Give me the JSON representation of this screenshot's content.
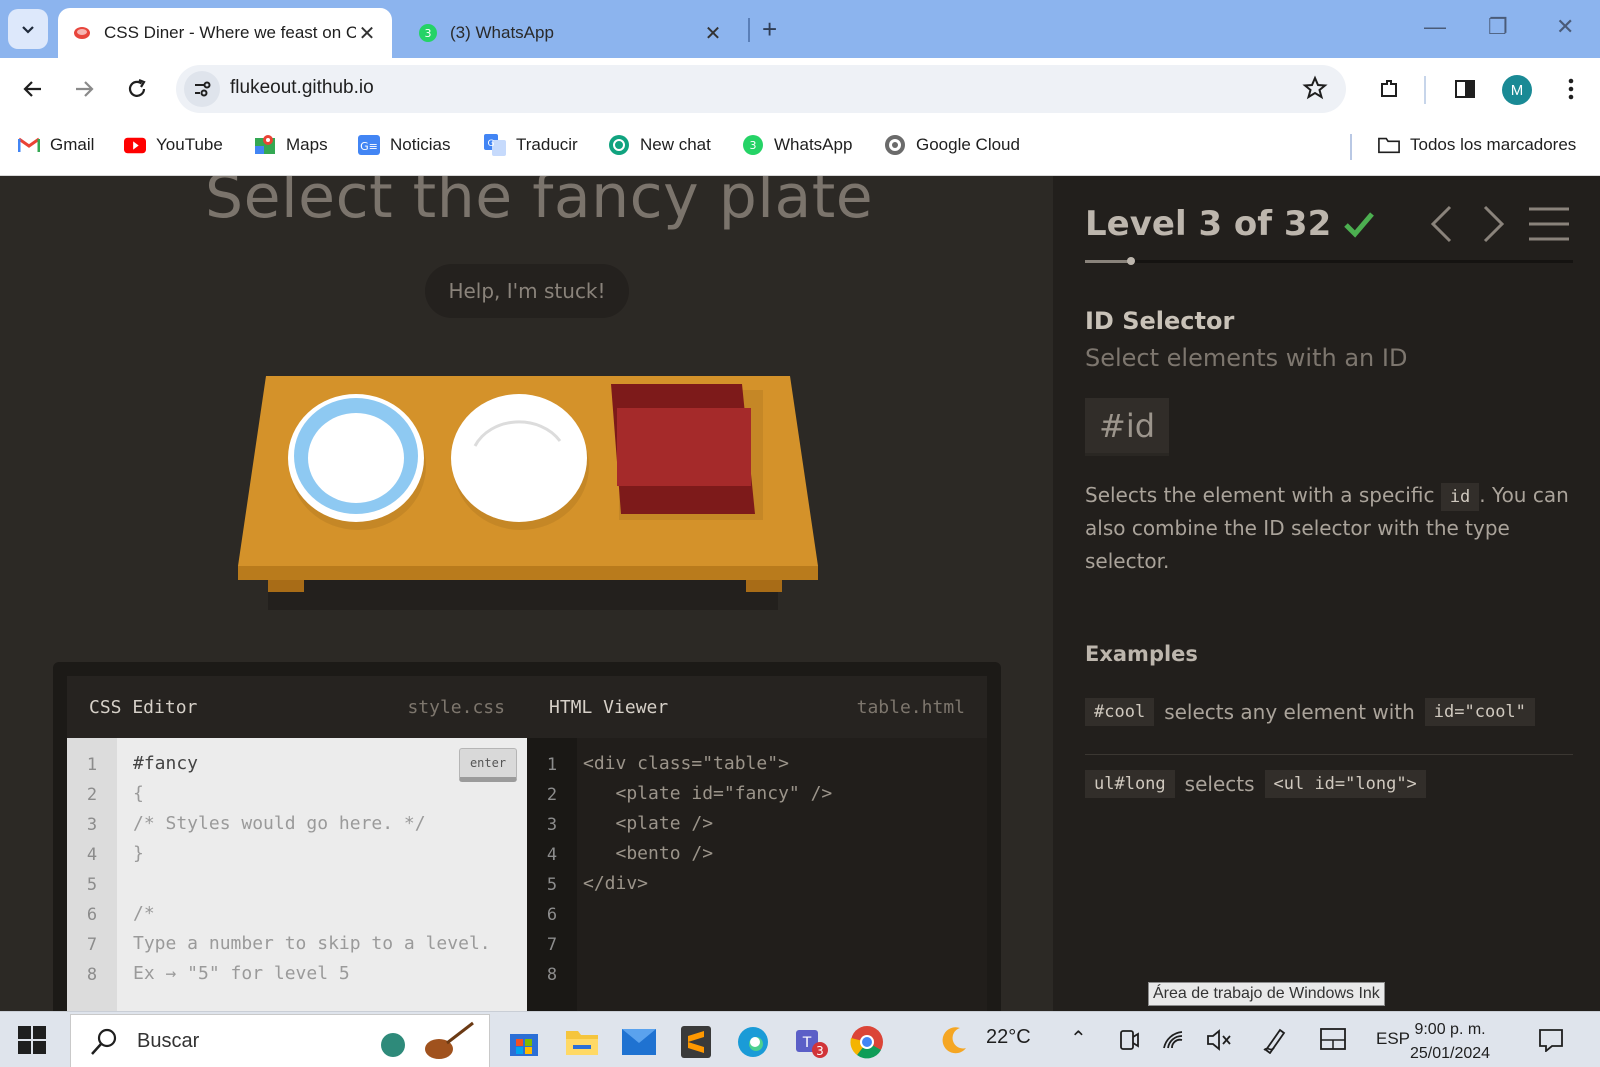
{
  "browser": {
    "tabs": [
      {
        "title": "CSS Diner - Where we feast on CSS Selectors!",
        "active": true
      },
      {
        "title": "(3) WhatsApp",
        "active": false
      }
    ],
    "url": "flukeout.github.io",
    "profile_initial": "M",
    "bookmarks": [
      "Gmail",
      "YouTube",
      "Maps",
      "Noticias",
      "Traducir",
      "New chat",
      "WhatsApp",
      "Google Cloud"
    ],
    "all_bookmarks_label": "Todos los marcadores"
  },
  "game": {
    "order": "Select the fancy plate",
    "help_label": "Help, I'm stuck!",
    "css_editor": {
      "title": "CSS Editor",
      "file": "style.css",
      "enter_label": "enter",
      "input": "#fancy",
      "lines": [
        "{",
        "/* Styles would go here. */",
        "}",
        "",
        "/*",
        "Type a number to skip to a level.",
        "Ex → \"5\" for level 5"
      ],
      "line_numbers": [
        "1",
        "2",
        "3",
        "4",
        "5",
        "6",
        "7",
        "8"
      ]
    },
    "html_viewer": {
      "title": "HTML Viewer",
      "file": "table.html",
      "lines": [
        "<div class=\"table\">",
        "   <plate id=\"fancy\" />",
        "   <plate />",
        "   <bento />",
        "</div>",
        "",
        "",
        ""
      ],
      "line_numbers": [
        "1",
        "2",
        "3",
        "4",
        "5",
        "6",
        "7",
        "8"
      ]
    }
  },
  "sidebar": {
    "level_label": "Level 3 of 32",
    "level_current": 3,
    "level_total": 32,
    "selector_name": "ID Selector",
    "selector_title": "Select elements with an ID",
    "syntax": "#id",
    "hint_before": "Selects the element with a specific",
    "hint_code": "id",
    "hint_after": ". You can also combine the ID selector with the type selector.",
    "examples_heading": "Examples",
    "examples": [
      {
        "code": "#cool",
        "text": "selects any element with",
        "code_after": "id=\"cool\""
      },
      {
        "code": "ul#long",
        "text": "selects",
        "code_after": "<ul id=\"long\">"
      }
    ]
  },
  "tooltip": "Área de trabajo de Windows Ink",
  "taskbar": {
    "search_placeholder": "Buscar",
    "teams_badge": "3",
    "weather": "22°C",
    "language": "ESP",
    "time": "9:00 p. m.",
    "date": "25/01/2024"
  },
  "colors": {
    "table": "#d4922a",
    "plate_fancy_rim": "#8ec9f2",
    "bento": "#a52a2a",
    "check": "#4caf50"
  }
}
